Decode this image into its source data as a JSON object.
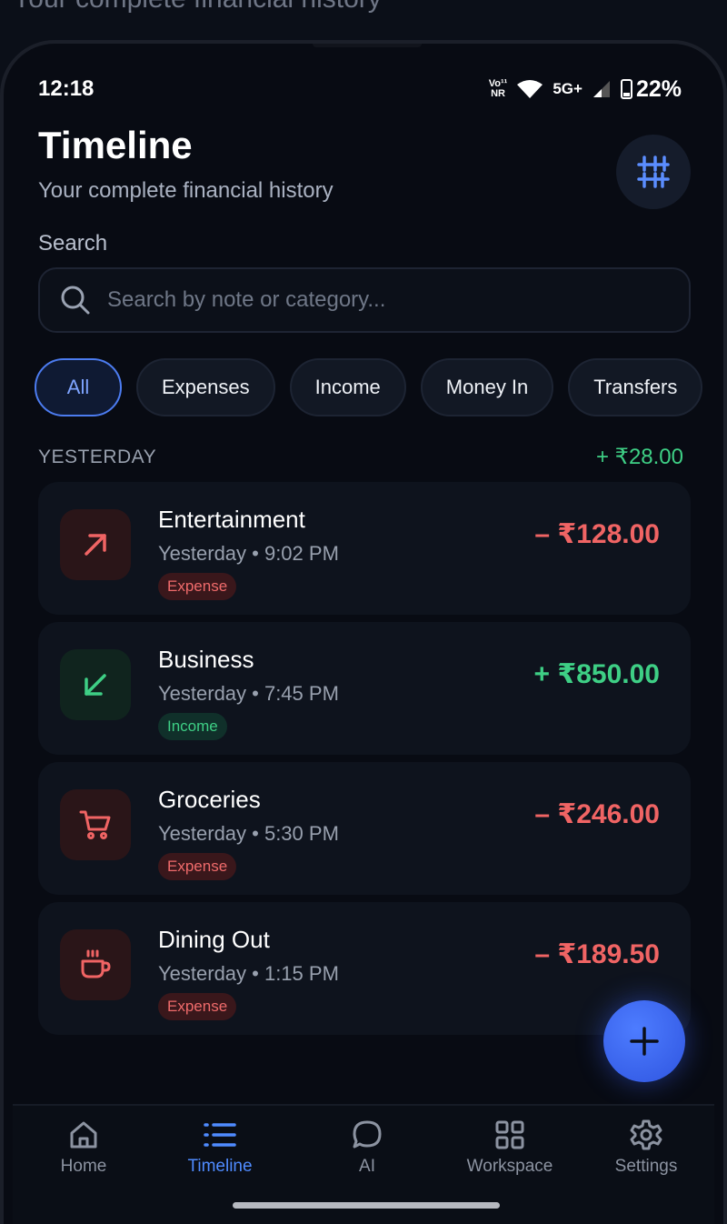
{
  "background_title": "Your complete financial history",
  "status_bar": {
    "time": "12:18",
    "volte_top": "Vo¹¹",
    "volte_bottom": "NR",
    "network": "5G+",
    "battery": "22%"
  },
  "header": {
    "title": "Timeline",
    "subtitle": "Your complete financial history",
    "filter_icon": "sliders-icon"
  },
  "search": {
    "label": "Search",
    "placeholder": "Search by note or category...",
    "value": ""
  },
  "chips": [
    {
      "label": "All",
      "active": true
    },
    {
      "label": "Expenses",
      "active": false
    },
    {
      "label": "Income",
      "active": false
    },
    {
      "label": "Money In",
      "active": false
    },
    {
      "label": "Transfers",
      "active": false
    }
  ],
  "group": {
    "label": "YESTERDAY",
    "total": "+ ₹28.00"
  },
  "transactions": [
    {
      "name": "Entertainment",
      "time": "Yesterday • 9:02 PM",
      "badge": "Expense",
      "amount": "– ₹128.00",
      "icon": "arrow-up-right-icon"
    },
    {
      "name": "Business",
      "time": "Yesterday • 7:45 PM",
      "badge": "Income",
      "amount": "+ ₹850.00",
      "icon": "arrow-down-left-icon"
    },
    {
      "name": "Groceries",
      "time": "Yesterday • 5:30 PM",
      "badge": "Expense",
      "amount": "– ₹246.00",
      "icon": "cart-icon"
    },
    {
      "name": "Dining Out",
      "time": "Yesterday • 1:15 PM",
      "badge": "Expense",
      "amount": "– ₹189.50",
      "icon": "coffee-cup-icon"
    }
  ],
  "nav": [
    {
      "label": "Home",
      "icon": "home-icon",
      "active": false
    },
    {
      "label": "Timeline",
      "icon": "list-icon",
      "active": true
    },
    {
      "label": "AI",
      "icon": "chat-bubble-icon",
      "active": false
    },
    {
      "label": "Workspace",
      "icon": "grid-icon",
      "active": false
    },
    {
      "label": "Settings",
      "icon": "gear-icon",
      "active": false
    }
  ],
  "colors": {
    "accent": "#4f8bff",
    "expense": "#f06464",
    "income": "#3ecf85",
    "background": "#080b13"
  }
}
